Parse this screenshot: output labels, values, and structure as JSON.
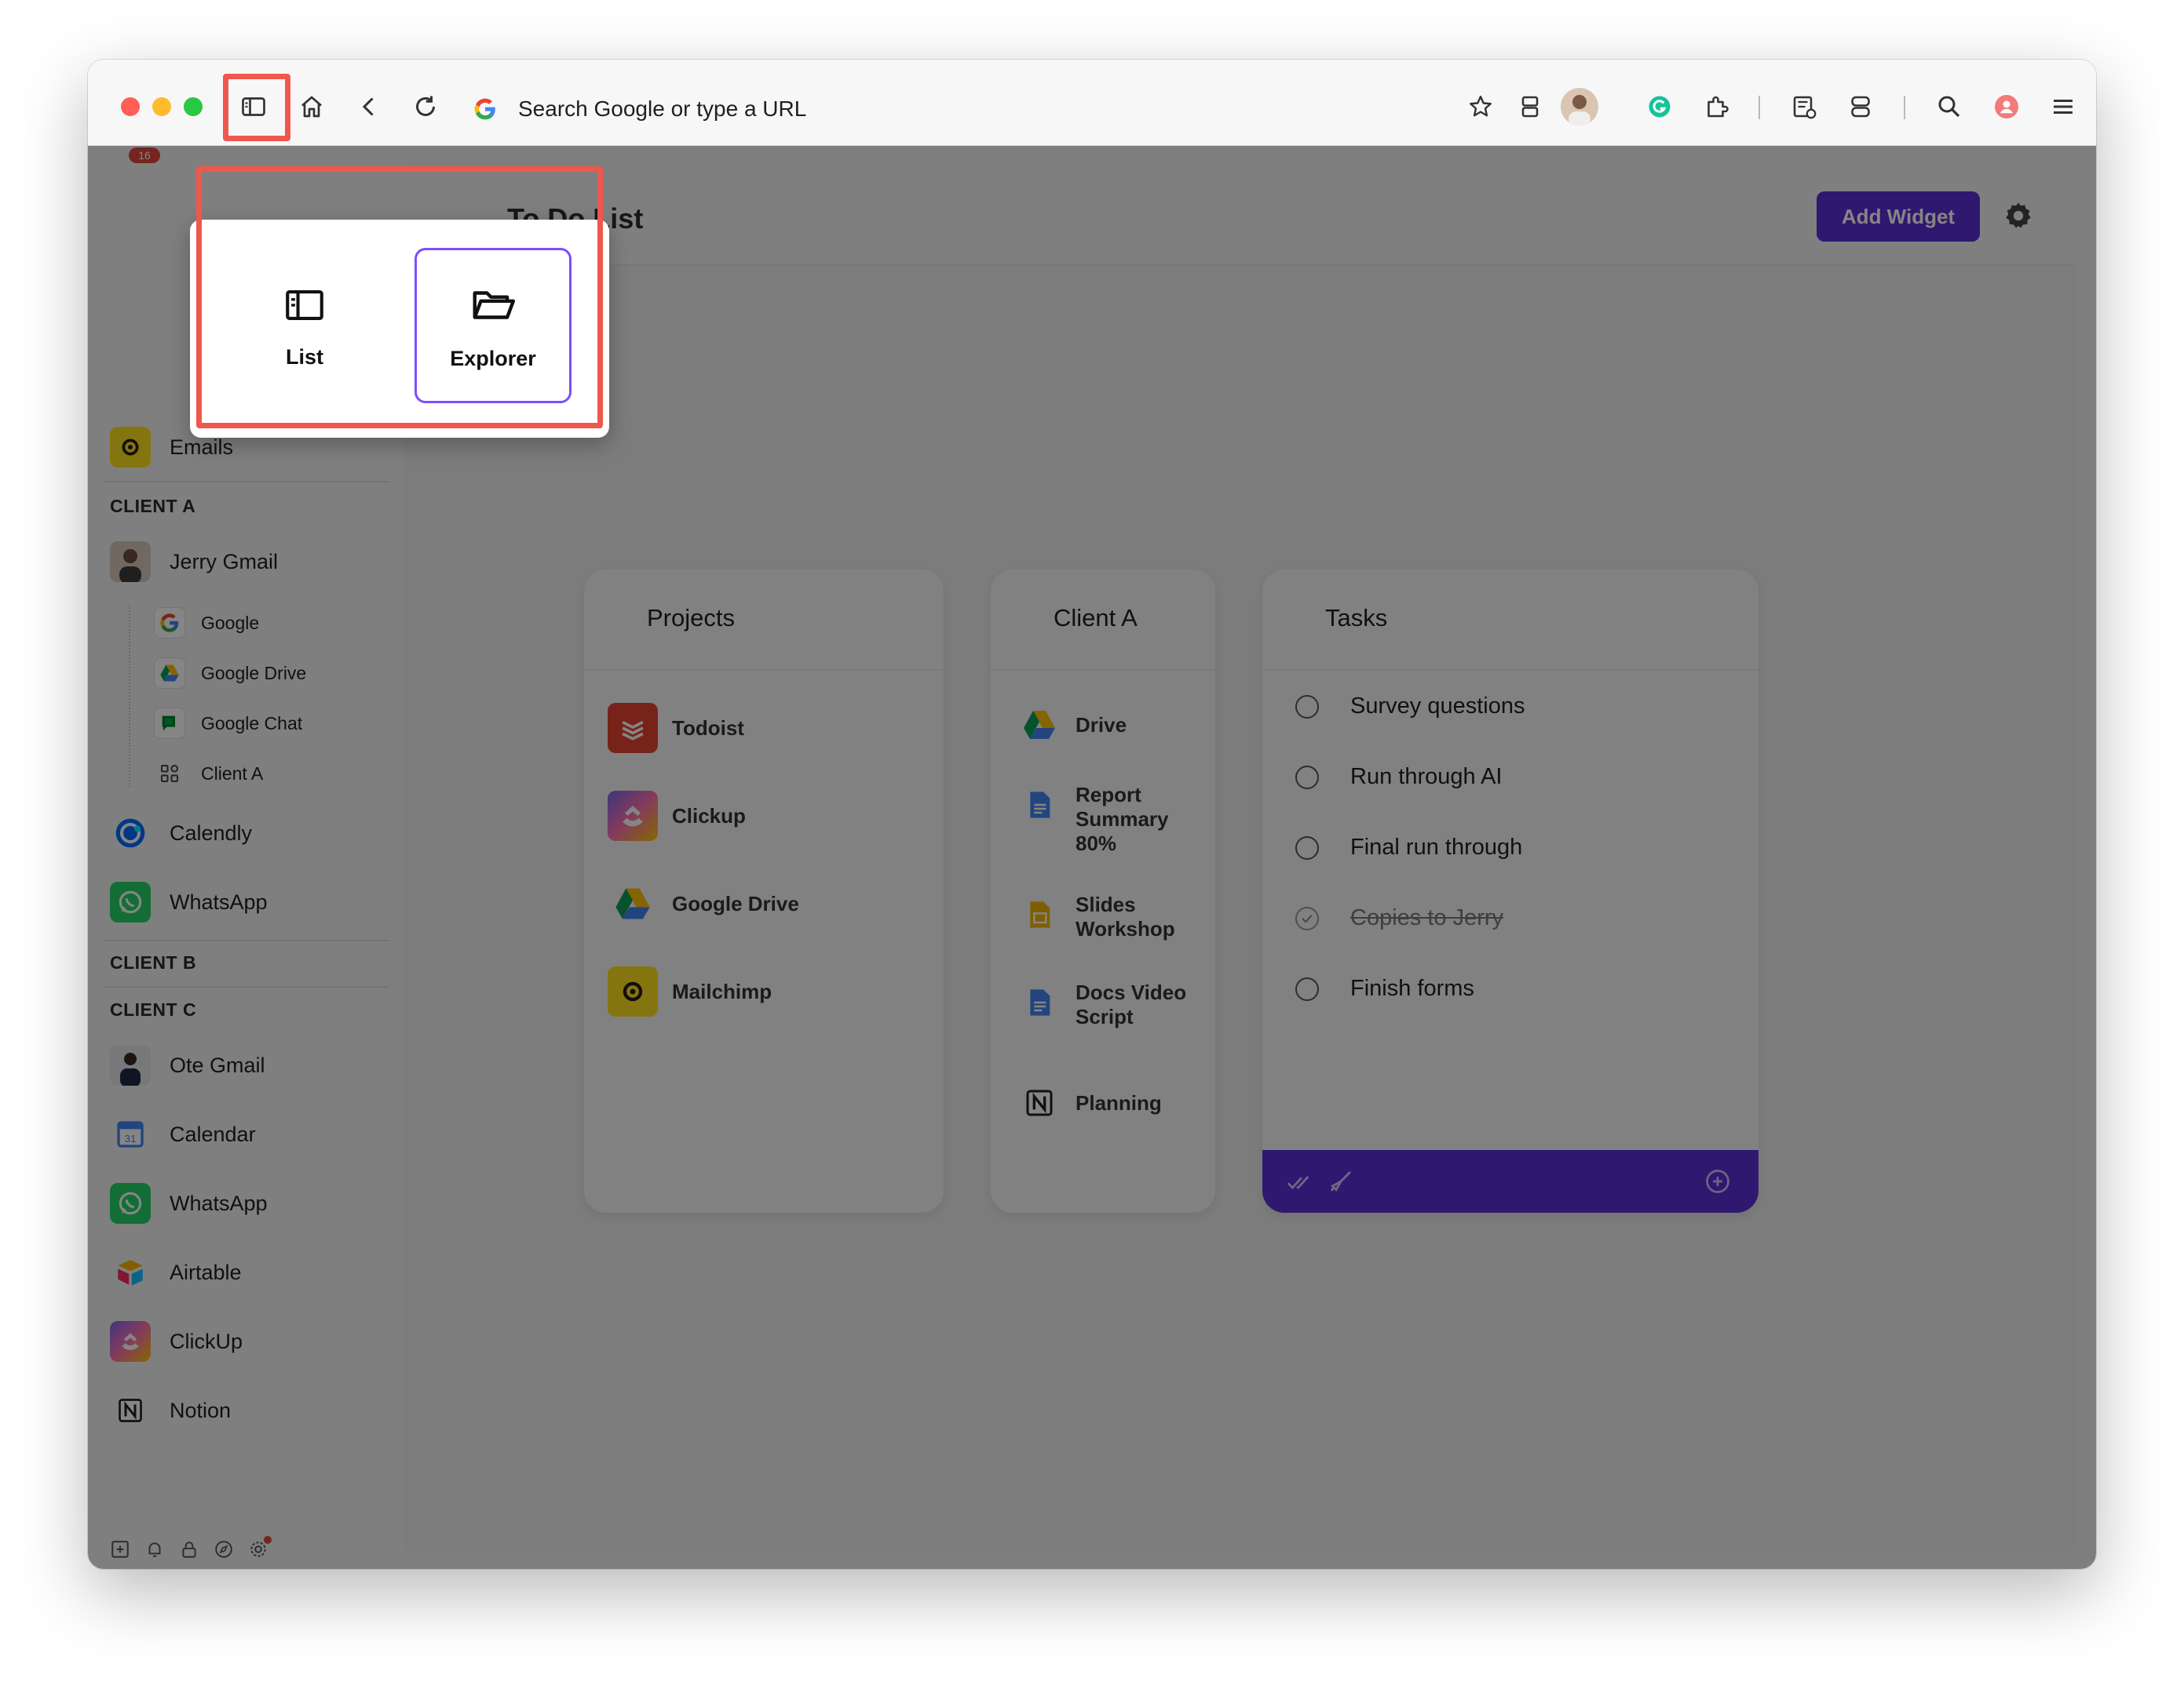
{
  "browser": {
    "omnibox_placeholder": "Search Google or type a URL"
  },
  "main": {
    "title": "To Do List",
    "add_widget_label": "Add Widget"
  },
  "notification_badge": "16",
  "sidebar": {
    "top_items": [
      {
        "label": "Emails",
        "icon": "mailchimp-icon"
      }
    ],
    "sections": {
      "client_a": "CLIENT A",
      "client_b": "CLIENT B",
      "client_c": "CLIENT C"
    },
    "client_a_items": [
      {
        "label": "Jerry Gmail",
        "icon": "jerry-avatar"
      },
      {
        "label": "Google",
        "icon": "google-icon"
      },
      {
        "label": "Google Drive",
        "icon": "google-drive-icon"
      },
      {
        "label": "Google Chat",
        "icon": "google-chat-icon"
      },
      {
        "label": "Client A",
        "icon": "grid-icon"
      },
      {
        "label": "Calendly",
        "icon": "calendly-icon"
      },
      {
        "label": "WhatsApp",
        "icon": "whatsapp-icon"
      }
    ],
    "client_c_items": [
      {
        "label": "Ote Gmail",
        "icon": "ote-avatar"
      },
      {
        "label": "Calendar",
        "icon": "calendar-icon"
      },
      {
        "label": "WhatsApp",
        "icon": "whatsapp-icon"
      },
      {
        "label": "Airtable",
        "icon": "airtable-icon"
      },
      {
        "label": "ClickUp",
        "icon": "clickup-icon"
      },
      {
        "label": "Notion",
        "icon": "notion-icon"
      }
    ]
  },
  "popover": {
    "options": [
      {
        "label": "List",
        "icon": "list-layout-icon",
        "selected": false
      },
      {
        "label": "Explorer",
        "icon": "folder-open-icon",
        "selected": true
      }
    ]
  },
  "cards": {
    "projects": {
      "title": "Projects",
      "items": [
        "Todoist",
        "Clickup",
        "Google Drive",
        "Mailchimp"
      ]
    },
    "client_a": {
      "title": "Client A",
      "items": [
        "Drive",
        "Report Summary 80%",
        "Slides Workshop",
        "Docs Video Script",
        "Planning"
      ]
    },
    "tasks": {
      "title": "Tasks",
      "items": [
        {
          "label": "Survey questions",
          "done": false
        },
        {
          "label": "Run through AI",
          "done": false
        },
        {
          "label": "Final run through",
          "done": false
        },
        {
          "label": "Copies to Jerry",
          "done": true
        },
        {
          "label": "Finish forms",
          "done": false
        }
      ]
    }
  },
  "colors": {
    "accent": "#5b2fd6",
    "highlight": "#f0574d",
    "selected_border": "#7c4dff"
  }
}
